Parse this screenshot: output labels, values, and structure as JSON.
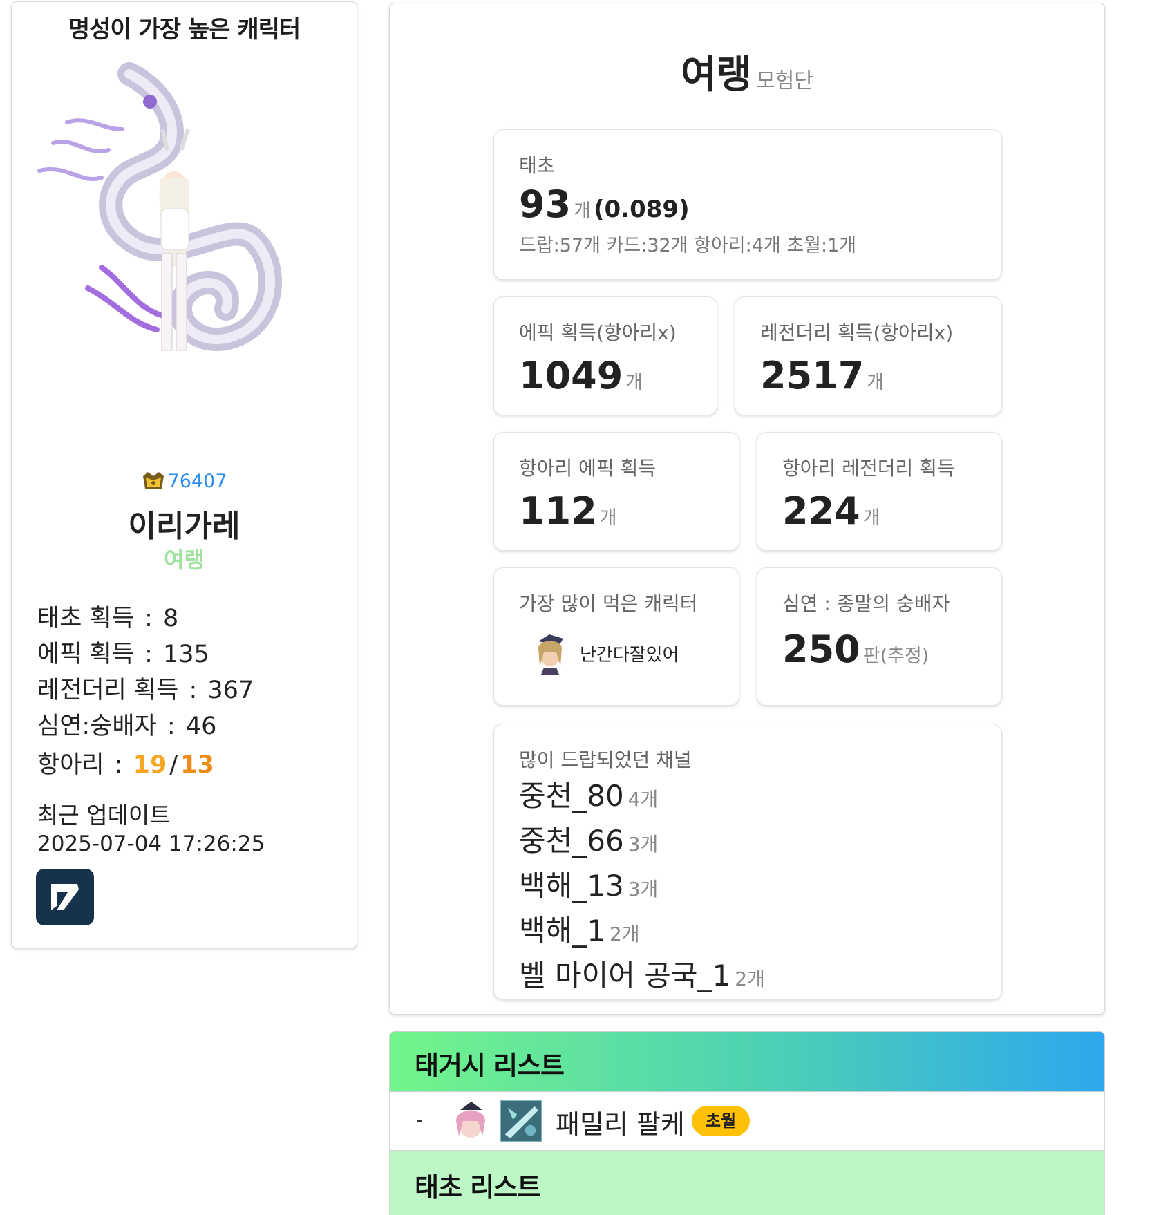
{
  "left_card": {
    "title": "명성이 가장 높은 캐릭터",
    "fame": "76407",
    "character_name": "이리가레",
    "guild_name": "여랭",
    "stats": [
      {
        "label": "태초 획득",
        "value": "8"
      },
      {
        "label": "에픽 획득",
        "value": "135"
      },
      {
        "label": "레전더리 획득",
        "value": "367"
      },
      {
        "label": "심연:숭배자",
        "value": "46"
      }
    ],
    "potion": {
      "label": "항아리",
      "a": "19",
      "slash": "/",
      "b": "13"
    },
    "update_label": "최근 업데이트",
    "update_time": "2025-07-04 17:26:25",
    "colors": {
      "fame": "#2d8cf0",
      "guild": "#9ee39c",
      "potion_a": "#f5a623",
      "potion_b": "#f08a18",
      "dundam_bg": "#17324d"
    }
  },
  "guild_panel": {
    "name": "여랭",
    "suffix": "모험단",
    "taecho": {
      "label": "태초",
      "value": "93",
      "unit": "개",
      "ratio": "(0.089)",
      "breakdown": "드랍:57개 카드:32개 항아리:4개 초월:1개"
    },
    "epic": {
      "label": "에픽 획득(항아리x)",
      "value": "1049",
      "unit": "개"
    },
    "legendary": {
      "label": "레전더리 획득(항아리x)",
      "value": "2517",
      "unit": "개"
    },
    "pot_epic": {
      "label": "항아리 에픽 획득",
      "value": "112",
      "unit": "개"
    },
    "pot_legendary": {
      "label": "항아리 레전더리 획득",
      "value": "224",
      "unit": "개"
    },
    "most_eaten": {
      "label": "가장 많이 먹은 캐릭터",
      "name": "난간다잘있어"
    },
    "abyss": {
      "label": "심연 : 종말의 숭배자",
      "value": "250",
      "unit": "판(추정)"
    },
    "channels": {
      "label": "많이 드랍되었던 채널",
      "items": [
        {
          "name": "중천_80",
          "count": "4개"
        },
        {
          "name": "중천_66",
          "count": "3개"
        },
        {
          "name": "백해_13",
          "count": "3개"
        },
        {
          "name": "백해_1",
          "count": "2개"
        },
        {
          "name": "벨 마이어 공국_1",
          "count": "2개"
        }
      ]
    }
  },
  "tagged_list": {
    "title": "태거시 리스트",
    "rows": [
      {
        "dash": "-",
        "name": "패밀리 팔케",
        "badge": "초월"
      }
    ],
    "colors": {
      "gradient_start": "#72f58a",
      "gradient_end": "#2fa7ee",
      "badge": "#ffc107"
    }
  },
  "taecho_list": {
    "title": "태초 리스트",
    "color": "#bdf7c6"
  },
  "icons": [
    "fame-crest-icon",
    "character-sprite",
    "dundam-logo-icon",
    "avatar-icon",
    "item-icon"
  ]
}
